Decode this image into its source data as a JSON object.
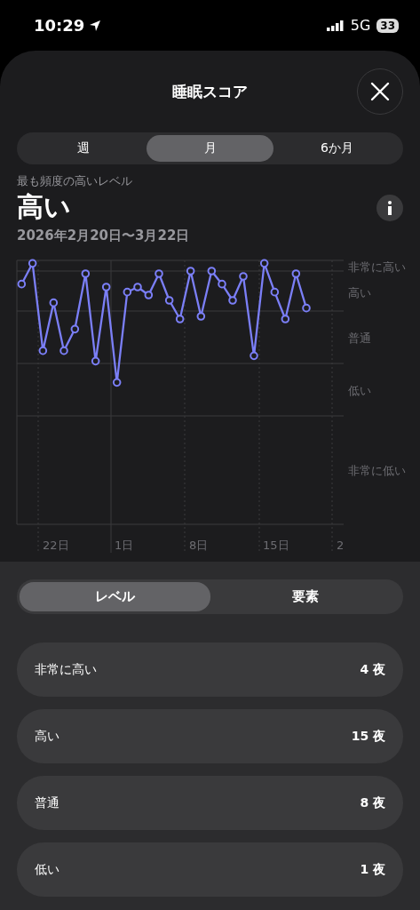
{
  "status_bar": {
    "time": "10:29",
    "network": "5G",
    "battery": "33"
  },
  "title": "睡眠スコア",
  "period_tabs": [
    {
      "label": "週",
      "selected": false
    },
    {
      "label": "月",
      "selected": true
    },
    {
      "label": "6か月",
      "selected": false
    }
  ],
  "summary": {
    "caption": "最も頻度の高いレベル",
    "value": "高い",
    "date_range": "2026年2月20日〜3月22日"
  },
  "chart": {
    "y_labels": [
      "非常に高い",
      "高い",
      "普通",
      "低い",
      "非常に低い"
    ],
    "x_labels": [
      "22日",
      "1日",
      "8日",
      "15日",
      "2"
    ]
  },
  "view_tabs": [
    {
      "label": "レベル",
      "selected": true
    },
    {
      "label": "要素",
      "selected": false
    }
  ],
  "levels": [
    {
      "name": "非常に高い",
      "count": "4",
      "unit": "夜"
    },
    {
      "name": "高い",
      "count": "15",
      "unit": "夜"
    },
    {
      "name": "普通",
      "count": "8",
      "unit": "夜"
    },
    {
      "name": "低い",
      "count": "1",
      "unit": "夜"
    }
  ]
}
